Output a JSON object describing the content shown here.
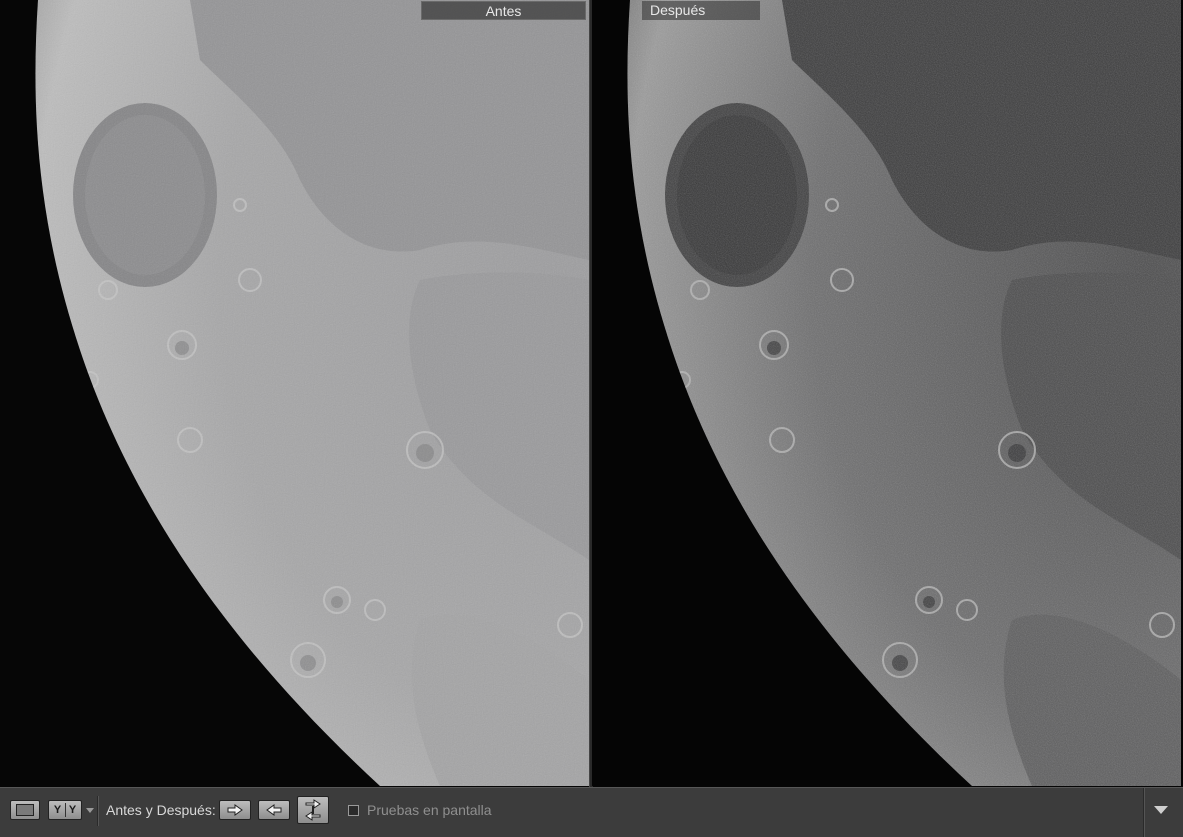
{
  "viewer": {
    "before_label": "Antes",
    "after_label": "Después"
  },
  "toolbar": {
    "view_mode_left": "Y",
    "view_mode_right": "Y",
    "before_after_label": "Antes y Después:",
    "soft_proofing_label": "Pruebas en pantalla",
    "soft_proofing_checked": false
  },
  "icons": {
    "loupe": "single-view-icon",
    "before_after_view": "before-after-view-icon",
    "copy_before_to_after": "arrow-right-icon",
    "copy_after_to_before": "arrow-left-icon",
    "swap": "swap-icon",
    "toolbar_menu": "chevron-down-icon"
  }
}
